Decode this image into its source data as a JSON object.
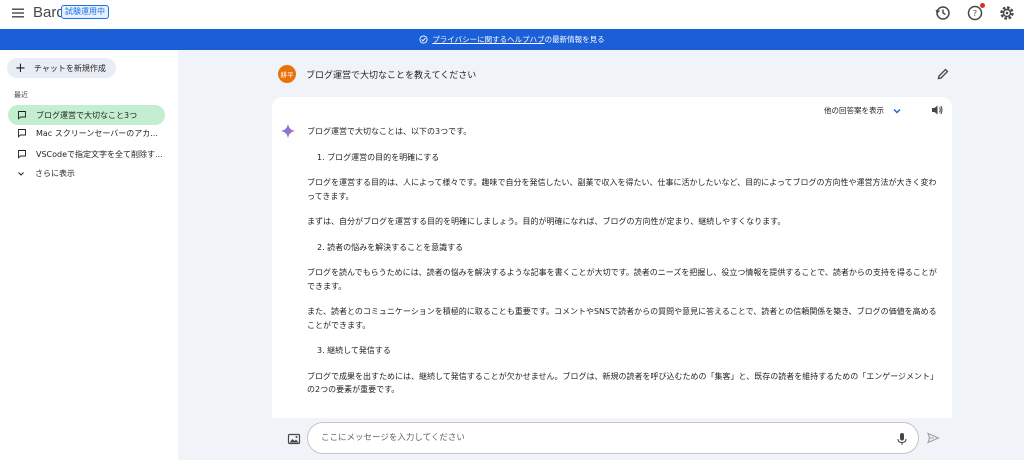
{
  "header": {
    "brand": "Bard",
    "badge": "試験運用中",
    "icons": [
      "menu-icon",
      "history-icon",
      "help-icon",
      "settings-icon"
    ]
  },
  "banner": {
    "icon": "check-circle-icon",
    "link_text": "プライバシーに関するヘルプハブ",
    "rest_text": "の最新情報を見る"
  },
  "sidebar": {
    "new_chat_label": "チャットを新規作成",
    "recent_label": "最近",
    "items": [
      {
        "label": "ブログ運営で大切なこと3つ",
        "active": true
      },
      {
        "label": "Mac スクリーンセーバーのアカ...",
        "active": false
      },
      {
        "label": "VSCodeで指定文字を全て削除す...",
        "active": false
      }
    ],
    "show_more_label": "さらに表示"
  },
  "conversation": {
    "avatar_text": "耕平",
    "prompt": "ブログ運営で大切なことを教えてください",
    "drafts_label": "他の回答案を表示",
    "response": [
      {
        "type": "p",
        "text": "ブログ運営で大切なことは、以下の3つです。"
      },
      {
        "type": "h",
        "text": "1. ブログ運営の目的を明確にする"
      },
      {
        "type": "p",
        "text": "ブログを運営する目的は、人によって様々です。趣味で自分を発信したい、副業で収入を得たい、仕事に活かしたいなど、目的によってブログの方向性や運営方法が大きく変わってきます。"
      },
      {
        "type": "p",
        "text": "まずは、自分がブログを運営する目的を明確にしましょう。目的が明確になれば、ブログの方向性が定まり、継続しやすくなります。"
      },
      {
        "type": "h",
        "text": "2. 読者の悩みを解決することを意識する"
      },
      {
        "type": "p",
        "text": "ブログを読んでもらうためには、読者の悩みを解決するような記事を書くことが大切です。読者のニーズを把握し、役立つ情報を提供することで、読者からの支持を得ることができます。"
      },
      {
        "type": "p",
        "text": "また、読者とのコミュニケーションを積極的に取ることも重要です。コメントやSNSで読者からの質問や意見に答えることで、読者との信頼関係を築き、ブログの価値を高めることができます。"
      },
      {
        "type": "h",
        "text": "3. 継続して発信する"
      },
      {
        "type": "p",
        "text": "ブログで成果を出すためには、継続して発信することが欠かせません。ブログは、新規の読者を呼び込むための「集客」と、既存の読者を維持するための「エンゲージメント」の2つの要素が重要です。"
      }
    ]
  },
  "input": {
    "placeholder": "ここにメッセージを入力してください"
  },
  "colors": {
    "banner": "#1a5fd8",
    "active_item": "#c4eed0",
    "avatar": "#e8710a",
    "main_bg": "#f0f4f9"
  }
}
